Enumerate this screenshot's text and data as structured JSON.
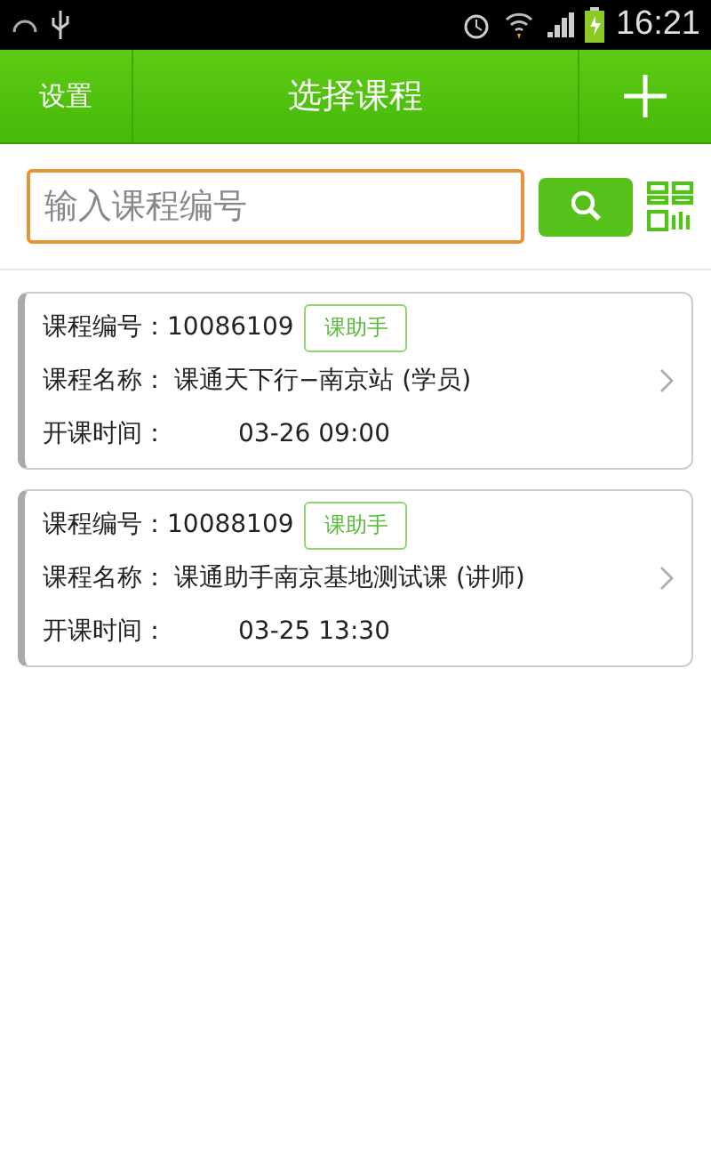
{
  "status_bar": {
    "time": "16:21"
  },
  "header": {
    "left_button": "设置",
    "title": "选择课程"
  },
  "search": {
    "placeholder": "输入课程编号"
  },
  "courses": [
    {
      "id_label": "课程编号：",
      "id": "10086109",
      "tag": "课助手",
      "name_label": "课程名称：",
      "name": "课通天下行−南京站 (学员)",
      "time_label": "开课时间：",
      "time": "03-26 09:00"
    },
    {
      "id_label": "课程编号：",
      "id": "10088109",
      "tag": "课助手",
      "name_label": "课程名称：",
      "name": "课通助手南京基地测试课 (讲师)",
      "time_label": "开课时间：",
      "time": "03-25 13:30"
    }
  ]
}
